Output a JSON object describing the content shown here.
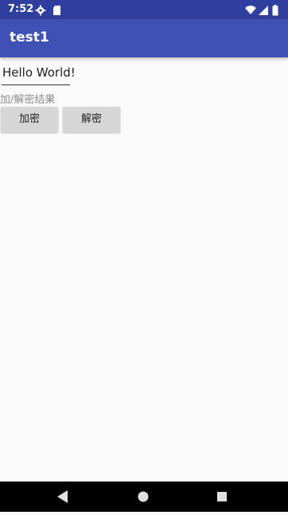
{
  "status_bar": {
    "time": "7:52",
    "icons": [
      "settings-icon",
      "sd-card-icon",
      "wifi-icon",
      "signal-icon",
      "battery-icon"
    ],
    "background": "#303F9F"
  },
  "app_bar": {
    "title": "test1",
    "background": "#3F51B5"
  },
  "main": {
    "input_value": "Hello World!",
    "result_label": "加/解密结果",
    "encrypt_button": "加密",
    "decrypt_button": "解密"
  },
  "nav_bar": {
    "icons": [
      "back-icon",
      "home-icon",
      "recents-icon"
    ]
  }
}
